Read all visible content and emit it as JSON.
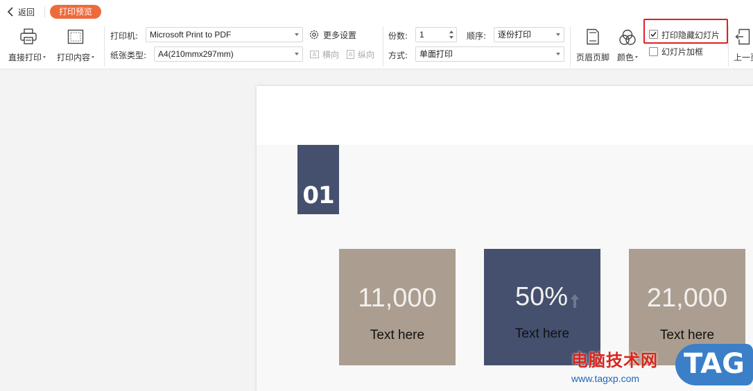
{
  "topbar": {
    "back_label": "返回",
    "mode_badge": "打印预览"
  },
  "toolbar": {
    "direct_print": "直接打印",
    "print_content": "打印内容",
    "printer_label": "打印机:",
    "printer_value": "Microsoft Print to PDF",
    "more_settings": "更多设置",
    "paper_label": "纸张类型:",
    "paper_value": "A4(210mmx297mm)",
    "landscape": "横向",
    "portrait": "纵向",
    "copies_label": "份数:",
    "copies_value": "1",
    "order_label": "顺序:",
    "order_value": "逐份打印",
    "method_label": "方式:",
    "method_value": "单面打印",
    "header_footer": "页眉页脚",
    "color": "颜色",
    "print_hidden_slides": "打印隐藏幻灯片",
    "print_hidden_slides_checked": true,
    "slide_frame": "幻灯片加框",
    "slide_frame_checked": false,
    "prev_page": "上一页",
    "highlight_color": "#e02020"
  },
  "slide": {
    "section_number": "01",
    "section_color": "#44506e",
    "tiles": [
      {
        "value": "11,000",
        "caption": "Text here",
        "color": "#ab9d8f"
      },
      {
        "value": "50%",
        "caption": "Text here",
        "color": "#44506e",
        "trend": "up-arrow"
      },
      {
        "value": "21,000",
        "caption": "Text here",
        "color": "#ab9d8f"
      }
    ]
  },
  "watermark": {
    "site_name": "电脑技术网",
    "url": "www.tagxp.com",
    "logo_text": "TAG"
  }
}
